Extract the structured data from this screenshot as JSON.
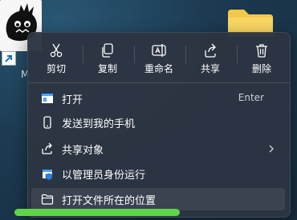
{
  "desktop": {
    "app_icon_label": "M",
    "folder_color": "#f2c84b"
  },
  "toolbar": {
    "cut_label": "剪切",
    "copy_label": "复制",
    "rename_label": "重命名",
    "share_label": "共享",
    "delete_label": "删除"
  },
  "menu": {
    "items": [
      {
        "label": "打开",
        "shortcut": "Enter",
        "icon": "open-window-icon"
      },
      {
        "label": "发送到我的手机",
        "icon": "phone-icon"
      },
      {
        "label": "共享对象",
        "icon": "share-icon",
        "has_submenu": true
      },
      {
        "label": "以管理员身份运行",
        "icon": "admin-shield-icon"
      },
      {
        "label": "打开文件所在的位置",
        "icon": "folder-outline-icon"
      }
    ]
  },
  "colors": {
    "menu_bg": "#2c3542",
    "highlight_marker": "#5fd34a",
    "accent_blue": "#4aa3ff"
  }
}
